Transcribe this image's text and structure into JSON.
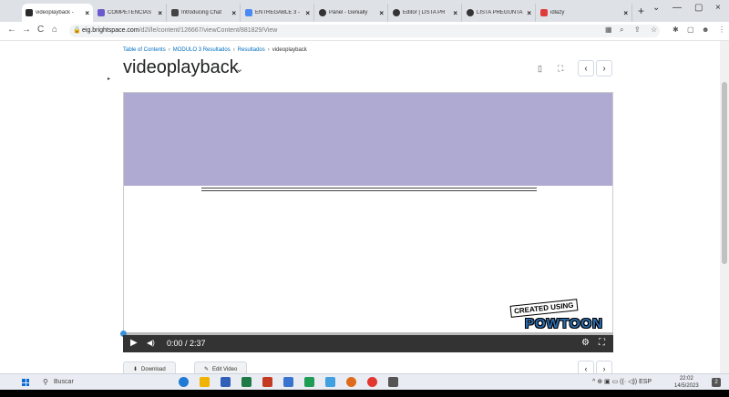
{
  "browser": {
    "tabs": [
      {
        "label": "videoplayback - ",
        "active": true,
        "favicon_color": "#2b2b2b"
      },
      {
        "label": "COMPETENCIAS",
        "favicon_color": "#6a5acd"
      },
      {
        "label": "Introducing Chat",
        "favicon_color": "#444444"
      },
      {
        "label": "ENTREGABLE 3 -",
        "favicon_color": "#4a8af4"
      },
      {
        "label": "Panel - Genially",
        "favicon_color": "#333333"
      },
      {
        "label": "Editor | LISTA PR",
        "favicon_color": "#333333"
      },
      {
        "label": "LISTA PREGUNTA",
        "favicon_color": "#333333"
      },
      {
        "label": "idlazy",
        "favicon_color": "#e03b3b"
      }
    ],
    "close_glyph": "×",
    "new_tab": "+",
    "window_controls": [
      "⌄",
      "—",
      "▢",
      "×"
    ],
    "nav": {
      "back": "←",
      "forward": "→",
      "reload": "C",
      "home": "⌂"
    },
    "url_host": "eig.brightspace.com",
    "url_path": "/d2l/le/content/126667/viewContent/881829/View",
    "lock": "🔒",
    "ext_icons": [
      "▦",
      "⌕",
      "⇪",
      "☆",
      "✱",
      "▢",
      "☻",
      "⋮"
    ]
  },
  "page": {
    "breadcrumb": [
      "Table of Contents",
      "MODULO 3 Resultados",
      "Resultados",
      "videoplayback"
    ],
    "breadcrumb_sep": "›",
    "title": "videoplayback",
    "title_chevron": "⌄",
    "collapse_glyph": "▸",
    "bookmark_icon": "▯",
    "fullscreen_icon": "⛶",
    "prev": "‹",
    "next": "›"
  },
  "video": {
    "band_color": "#aeaad2",
    "created_text": "CREATED USING",
    "brand_text": "POWTOON",
    "play": "▶",
    "volume": "◀)",
    "time": "0:00 / 2:37",
    "progress": 0,
    "settings": "⚙",
    "fullscreen": "⛶"
  },
  "actions": {
    "download": "Download",
    "download_icon": "⬇",
    "edit": "Edit Video",
    "edit_icon": "✎"
  },
  "taskbar": {
    "search_placeholder": "Buscar",
    "search_icon": "⚲",
    "apps": [
      "#1f7ad6",
      "#f0b400",
      "#2f5fb8",
      "#1e7b45",
      "#c23b22",
      "#3a74d1",
      "#1f9d55",
      "#40a0e0",
      "#e06a1b",
      "#e2362f",
      "#555555"
    ],
    "tray": "^ ⊕ ▣ ▭ ((· ◁)) ESP",
    "time": "22:02",
    "date": "14/5/2023",
    "notifications": "2"
  }
}
